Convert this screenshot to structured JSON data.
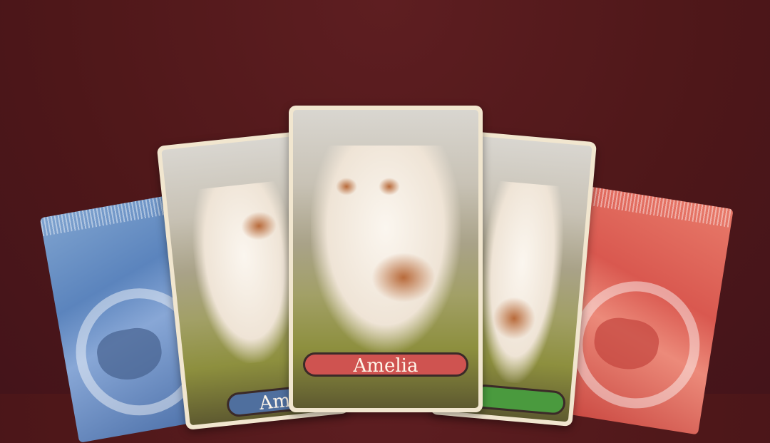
{
  "colors": {
    "background": "#501719",
    "card_frame": "#f1e6cf",
    "label_red": "#cf5350",
    "label_blue": "#4f6f9e",
    "label_green": "#4a9a3e",
    "pack_blue": "#6b8fc6",
    "pack_red": "#dd5e53"
  },
  "packs": [
    {
      "color": "blue",
      "icon": "dog-head-icon"
    },
    {
      "color": "red",
      "icon": "dog-head-icon"
    }
  ],
  "cards": {
    "center": {
      "name": "Amelia"
    },
    "left": {
      "name": "Ame"
    },
    "right": {
      "name": ""
    }
  }
}
